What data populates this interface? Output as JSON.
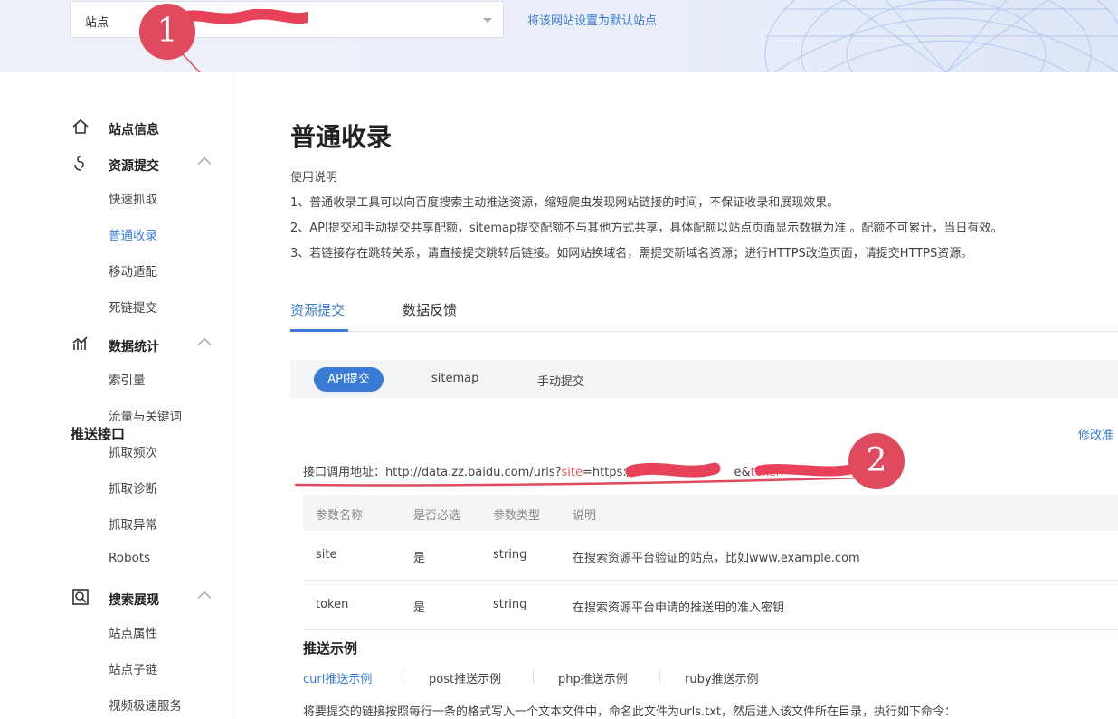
{
  "header": {
    "site_select_label": "站点",
    "default_link": "将该网站设置为默认站点"
  },
  "annotations": {
    "marker1": "1",
    "marker2": "2"
  },
  "sidebar": {
    "groups": [
      {
        "label": "站点信息",
        "icon": "home-icon",
        "items": []
      },
      {
        "label": "资源提交",
        "icon": "submit-icon",
        "items": [
          "快速抓取",
          "普通收录",
          "移动适配",
          "死链提交"
        ]
      },
      {
        "label": "数据统计",
        "icon": "stats-icon",
        "items": [
          "索引量",
          "流量与关键词",
          "抓取频次",
          "抓取诊断",
          "抓取异常",
          "Robots"
        ]
      },
      {
        "label": "搜索展现",
        "icon": "search-display-icon",
        "items": [
          "站点属性",
          "站点子链",
          "视频极速服务"
        ]
      }
    ],
    "active_item": "普通收录"
  },
  "main": {
    "title": "普通收录",
    "usage_title": "使用说明",
    "usage_lines": [
      "1、普通收录工具可以向百度搜索主动推送资源，缩短爬虫发现网站链接的时间，不保证收录和展现效果。",
      "2、API提交和手动提交共享配额，sitemap提交配额不与其他方式共享，具体配额以站点页面显示数据为准 。配额不可累计，当日有效。",
      "3、若链接存在跳转关系，请直接提交跳转后链接。如网站换域名，需提交新域名资源；进行HTTPS改造页面，请提交HTTPS资源。"
    ],
    "tabs": [
      "资源提交",
      "数据反馈"
    ],
    "subtabs": [
      "API提交",
      "sitemap",
      "手动提交"
    ],
    "push_title": "推送接口",
    "edit_link": "修改准",
    "url": {
      "prefix": "接口调用地址：http://data.zz.baidu.com/urls?",
      "site_key": "site",
      "mid": "=https://",
      "mid2": "e&",
      "token_key": "token",
      "suffix": "="
    },
    "table": {
      "headers": [
        "参数名称",
        "是否必选",
        "参数类型",
        "说明"
      ],
      "rows": [
        [
          "site",
          "是",
          "string",
          "在搜索资源平台验证的站点，比如www.example.com"
        ],
        [
          "token",
          "是",
          "string",
          "在搜索资源平台申请的推送用的准入密钥"
        ]
      ]
    },
    "example_title": "推送示例",
    "example_tabs": [
      "curl推送示例",
      "post推送示例",
      "php推送示例",
      "ruby推送示例"
    ],
    "example_note": "将要提交的链接按照每行一条的格式写入一个文本文件中，命名此文件为urls.txt，然后进入该文件所在目录，执行如下命令："
  },
  "colors": {
    "accent": "#3a7bd5",
    "annotation": "#e04a5e",
    "param_key": "#e55a5a"
  }
}
